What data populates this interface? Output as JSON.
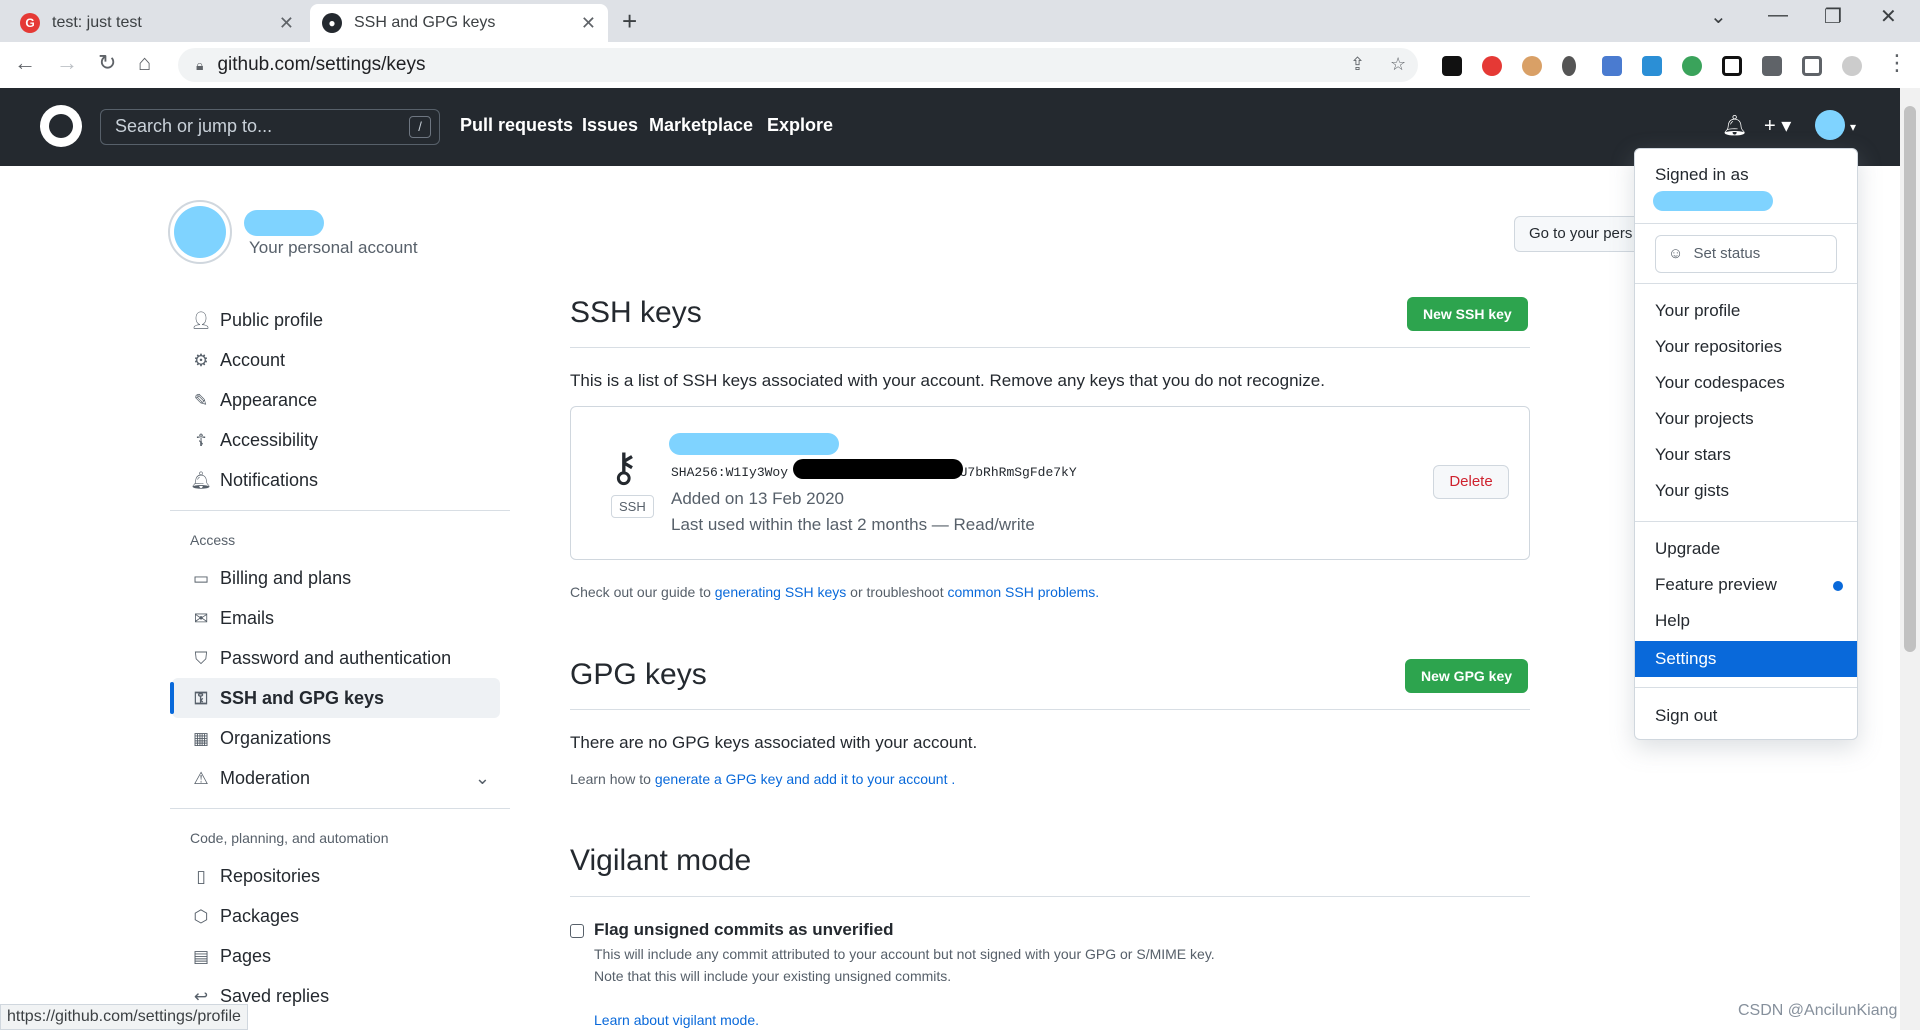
{
  "browser": {
    "tabs": [
      {
        "title": "test: just test",
        "active": false,
        "favicon": "g-letter-icon",
        "favicon_color": "#e53935"
      },
      {
        "title": "SSH and GPG keys",
        "active": true,
        "favicon": "github-icon",
        "favicon_color": "#24292f"
      }
    ],
    "url": "github.com/settings/keys",
    "status_url": "https://github.com/settings/profile"
  },
  "header": {
    "search_placeholder": "Search or jump to...",
    "search_shortcut": "/",
    "nav": [
      "Pull requests",
      "Issues",
      "Marketplace",
      "Explore"
    ]
  },
  "account": {
    "subtitle": "Your personal account",
    "goto_button": "Go to your pers"
  },
  "sidebar": {
    "items_top": [
      "Public profile",
      "Account",
      "Appearance",
      "Accessibility",
      "Notifications"
    ],
    "access_heading": "Access",
    "items_access": [
      "Billing and plans",
      "Emails",
      "Password and authentication",
      "SSH and GPG keys",
      "Organizations",
      "Moderation"
    ],
    "code_heading": "Code, planning, and automation",
    "items_code": [
      "Repositories",
      "Packages",
      "Pages",
      "Saved replies"
    ],
    "active": "SSH and GPG keys"
  },
  "ssh": {
    "title": "SSH keys",
    "new_button": "New SSH key",
    "description": "This is a list of SSH keys associated with your account. Remove any keys that you do not recognize.",
    "key": {
      "type_label": "SSH",
      "fingerprint_start": "SHA256:W1Iy3Woy",
      "fingerprint_end": "sJU7bRhRmSgFde7kY",
      "added": "Added on 13 Feb 2020",
      "last_used": "Last used within the last 2 months — Read/write",
      "delete_button": "Delete"
    },
    "guide_prefix": "Check out our guide to ",
    "guide_link1": "generating SSH keys",
    "guide_middle": " or troubleshoot ",
    "guide_link2": "common SSH problems",
    "guide_suffix": "."
  },
  "gpg": {
    "title": "GPG keys",
    "new_button": "New GPG key",
    "none_text": "There are no GPG keys associated with your account.",
    "learn_prefix": "Learn how to ",
    "learn_link": "generate a GPG key and add it to your account",
    "learn_suffix": " ."
  },
  "vigilant": {
    "title": "Vigilant mode",
    "checkbox_label": "Flag unsigned commits as unverified",
    "help1": "This will include any commit attributed to your account but not signed with your GPG or S/MIME key.",
    "help2": "Note that this will include your existing unsigned commits.",
    "learn_link": "Learn about vigilant mode."
  },
  "dropdown": {
    "signed_in": "Signed in as",
    "set_status": "Set status",
    "items1": [
      "Your profile",
      "Your repositories",
      "Your codespaces",
      "Your projects",
      "Your stars",
      "Your gists"
    ],
    "items2": [
      "Upgrade",
      "Feature preview",
      "Help",
      "Settings"
    ],
    "signout": "Sign out",
    "selected": "Settings"
  },
  "watermark": "CSDN @AncilunKiang"
}
